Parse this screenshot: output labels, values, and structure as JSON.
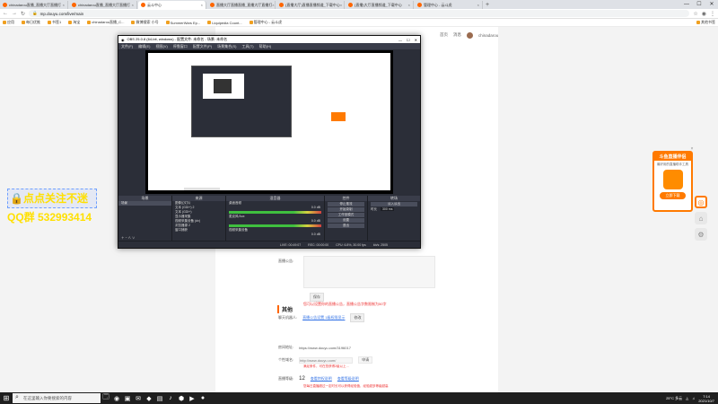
{
  "browser": {
    "tabs": [
      {
        "label": "chinadarou直播_直播大厅直播打",
        "active": false
      },
      {
        "label": "chinadarou直播_直播大厅直播打",
        "active": false
      },
      {
        "label": "云斗中心",
        "active": true
      },
      {
        "label": "直播大厅直播直播_直播大厅直播打",
        "active": false
      },
      {
        "label": "(直播大厅)直播直播频道_下载中心",
        "active": false
      },
      {
        "label": "(直播)大厅直播频道_下载中心",
        "active": false
      },
      {
        "label": "管理中心 - 云斗虎",
        "active": false
      }
    ],
    "new_tab": "+",
    "window_controls": [
      "—",
      "☐",
      "✕"
    ],
    "url": "mp.douyu.com/live/main",
    "bookmarks": [
      "应用",
      "每日优推",
      "书签1",
      "淘宝",
      "chinadarou直播_C...",
      "微博搜索 小号",
      "SummerWars Ep...",
      "Liquipedia Count...",
      "管理中心 - 云斗虎"
    ],
    "other_bookmarks": "其他书签"
  },
  "site": {
    "header_items": [
      "首页",
      "消息"
    ],
    "user_name": "chinadarou"
  },
  "overlay": {
    "line1": "🔒点点关注不迷",
    "line2": "QQ群 532993414"
  },
  "form": {
    "field_label_1": "直播公告:",
    "field_label_2": "聊天机器人:",
    "field_value_2": "直播公告设置 1级权限显示",
    "save_label": "保存",
    "red_note_1": "您可以设置你的直播公告，直播公告字数限制为50字",
    "modify_label": "修改",
    "section_title": "其他",
    "room_url_label": "房间地址:",
    "room_url_value": "https://www.douyu.com/3196017",
    "custom_url_label": "个性域名:",
    "custom_url_placeholder": "http://www.douyu.com/",
    "custom_url_select": "申请",
    "red_note_2": "满足条件，可在您获得2级以上…",
    "level_label": "直播等级:",
    "level_value": "12",
    "level_link_1": "查看特权说明",
    "level_link_2": "查看等级说明",
    "red_note_3": "您每日直播超过一定时长可以获得经验值，经验越多等级越高"
  },
  "promo": {
    "title": "斗鱼直播伴侣",
    "subtitle": "最好用的直播助手工具",
    "button": "立即下载"
  },
  "obs": {
    "title": "OBS 25.0.8 (64-bit, windows) - 配置文件: 未命名 - 场景: 未命名",
    "window_controls": [
      "—",
      "☐",
      "✕"
    ],
    "menu": [
      "文件(F)",
      "编辑(E)",
      "视图(V)",
      "停靠窗口",
      "配置文件(P)",
      "场景集合(S)",
      "工具(T)",
      "帮助(H)"
    ],
    "docks": {
      "scenes_header": "场景",
      "scene_item": "场景",
      "sources_header": "来源",
      "sources": [
        "图像幻灯片",
        "文本 (GDI+) 2",
        "文本 (GDI+)",
        "显示器采集",
        "视频采集设备 (dv)",
        "浏览器源 2",
        "窗口捕获"
      ],
      "mixer_header": "混音器",
      "mixer_tracks": [
        {
          "name": "桌面音频",
          "level": "0.0 dB"
        },
        {
          "name": "麦克风/Aux",
          "level": "0.0 dB"
        },
        {
          "name": "视频采集设备",
          "level": "0.0 dB"
        }
      ],
      "transitions_header": "转场",
      "transition_type": "淡入淡出",
      "duration_label": "时长",
      "duration_value": "300 ms",
      "controls_header": "控件",
      "controls": [
        "停止推流",
        "开始录制",
        "工作室模式",
        "设置",
        "退出"
      ]
    },
    "status": [
      "LIVE: 00:49:07",
      "REC: 00:00:00",
      "CPU: 6.8%, 30.00 fps",
      "kb/s: 2505"
    ]
  },
  "taskbar": {
    "search_placeholder": "在这里输入你要搜索的内容",
    "apps": [
      "🗔",
      "◉",
      "▣",
      "✉",
      "◆",
      "▤",
      "♪",
      "⬢",
      "▶",
      "●"
    ],
    "weather": "25°C 多云",
    "time": "7:14",
    "date": "2021/10/7"
  }
}
